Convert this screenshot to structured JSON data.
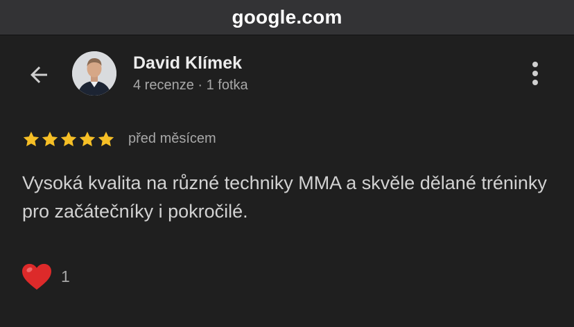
{
  "browser": {
    "url_label": "google.com"
  },
  "reviewer": {
    "name": "David Klímek",
    "stats": "4 recenze · 1 fotka"
  },
  "review": {
    "rating": 5,
    "rating_max": 5,
    "time": "před měsícem",
    "text": "Vysoká kvalita na různé techniky MMA a skvěle dělané tréninky pro začátečníky i pokročilé."
  },
  "reactions": {
    "likes": "1"
  },
  "icons": {
    "back": "arrow-left-icon",
    "menu": "more-vertical-icon",
    "star": "star-icon",
    "heart": "heart-icon"
  },
  "colors": {
    "background": "#1f1f1f",
    "url_bar": "#333335",
    "star": "#f6bf26",
    "heart": "#dd2a2a"
  }
}
